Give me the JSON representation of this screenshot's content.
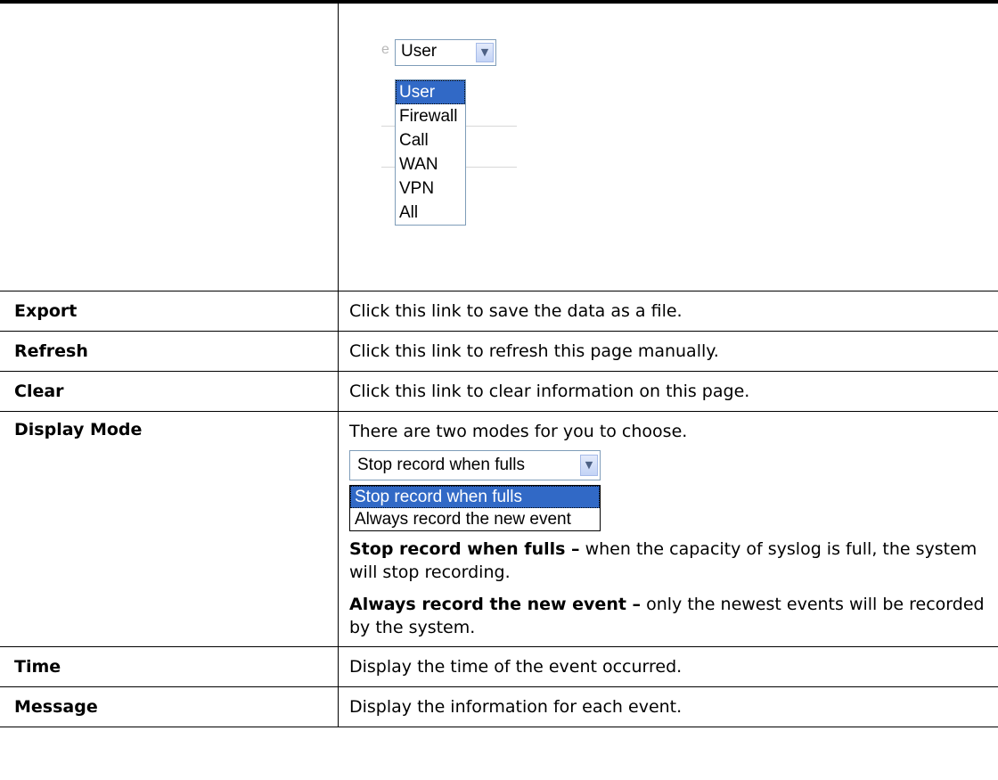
{
  "log_type_dropdown": {
    "ghost_char": "e",
    "selected": "User",
    "options": [
      "User",
      "Firewall",
      "Call",
      "WAN",
      "VPN",
      "All"
    ]
  },
  "rows": {
    "export": {
      "term": "Export",
      "desc": "Click this link to save the data as a file."
    },
    "refresh": {
      "term": "Refresh",
      "desc": "Click this link to refresh this page manually."
    },
    "clear": {
      "term": "Clear",
      "desc": "Click this link to clear information on this page."
    },
    "display_mode": {
      "term": "Display Mode",
      "intro": "There are two modes for you to choose.",
      "dropdown": {
        "selected": "Stop record when fulls",
        "options": [
          "Stop record when fulls",
          "Always record the new event"
        ]
      },
      "stop_bold": "Stop record when fulls –",
      "stop_text": " when the capacity of syslog is full, the system will stop recording.",
      "always_bold": "Always record the new event –",
      "always_text": " only the newest events will be recorded by the system."
    },
    "time": {
      "term": "Time",
      "desc": "Display the time of the event occurred."
    },
    "message": {
      "term": "Message",
      "desc": "Display the information for each event."
    }
  },
  "colors": {
    "highlight": "#3169c6",
    "select_border": "#7f9db9"
  }
}
